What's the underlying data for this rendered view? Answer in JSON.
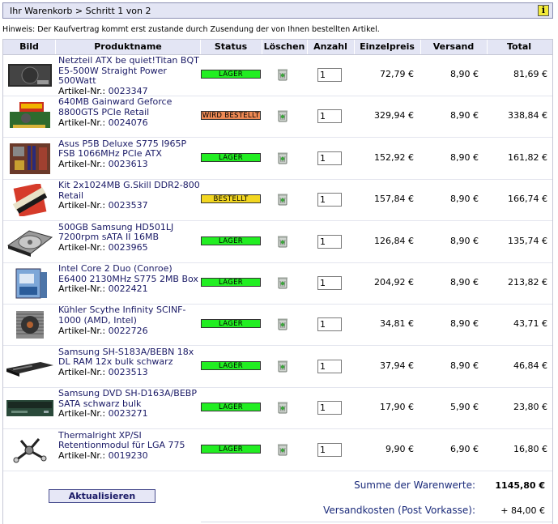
{
  "breadcrumb": "Ihr Warenkorb > Schritt 1 von 2",
  "info_icon": "i",
  "hint": "Hinweis: Der Kaufvertrag kommt erst zustande durch Zusendung der von Ihnen bestellten Artikel.",
  "columns": {
    "bild": "Bild",
    "produktname": "Produktname",
    "status": "Status",
    "loeschen": "Löschen",
    "anzahl": "Anzahl",
    "einzelpreis": "Einzelpreis",
    "versand": "Versand",
    "total": "Total"
  },
  "article_label": "Artikel-Nr.:",
  "status_colors": {
    "LAGER": "#22ee22",
    "WIRD BESTELLT": "#ee8a55",
    "BESTELLT": "#f2d620"
  },
  "items": [
    {
      "name": "Netzteil ATX be quiet!Titan BQT E5-500W Straight Power 500Watt",
      "article": "0023347",
      "status": "LAGER",
      "qty": "1",
      "unit_price": "72,79 €",
      "shipping": "8,90 €",
      "total": "81,69 €",
      "thumb": "psu-image"
    },
    {
      "name": "640MB Gainward Geforce 8800GTS PCIe Retail",
      "article": "0024076",
      "status": "WIRD BESTELLT",
      "qty": "1",
      "unit_price": "329,94 €",
      "shipping": "8,90 €",
      "total": "338,84 €",
      "thumb": "graphics-card-image"
    },
    {
      "name": "Asus P5B Deluxe S775 I965P FSB 1066MHz PCIe ATX",
      "article": "0023613",
      "status": "LAGER",
      "qty": "1",
      "unit_price": "152,92 €",
      "shipping": "8,90 €",
      "total": "161,82 €",
      "thumb": "motherboard-image"
    },
    {
      "name": "Kit 2x1024MB G.Skill DDR2-800 Retail",
      "article": "0023537",
      "status": "BESTELLT",
      "qty": "1",
      "unit_price": "157,84 €",
      "shipping": "8,90 €",
      "total": "166,74 €",
      "thumb": "ram-kit-image"
    },
    {
      "name": "500GB Samsung HD501LJ 7200rpm sATA II 16MB",
      "article": "0023965",
      "status": "LAGER",
      "qty": "1",
      "unit_price": "126,84 €",
      "shipping": "8,90 €",
      "total": "135,74 €",
      "thumb": "hard-drive-image"
    },
    {
      "name": "Intel Core 2 Duo (Conroe) E6400 2130MHz S775 2MB Box",
      "article": "0022421",
      "status": "LAGER",
      "qty": "1",
      "unit_price": "204,92 €",
      "shipping": "8,90 €",
      "total": "213,82 €",
      "thumb": "cpu-box-image"
    },
    {
      "name": "Kühler Scythe Infinity SCINF-1000 (AMD, Intel)",
      "article": "0022726",
      "status": "LAGER",
      "qty": "1",
      "unit_price": "34,81 €",
      "shipping": "8,90 €",
      "total": "43,71 €",
      "thumb": "cpu-cooler-image"
    },
    {
      "name": "Samsung SH-S183A/BEBN 18x DL RAM 12x bulk schwarz",
      "article": "0023513",
      "status": "LAGER",
      "qty": "1",
      "unit_price": "37,94 €",
      "shipping": "8,90 €",
      "total": "46,84 €",
      "thumb": "dvd-burner-image"
    },
    {
      "name": "Samsung DVD SH-D163A/BEBP SATA schwarz bulk",
      "article": "0023271",
      "status": "LAGER",
      "qty": "1",
      "unit_price": "17,90 €",
      "shipping": "5,90 €",
      "total": "23,80 €",
      "thumb": "dvd-drive-image"
    },
    {
      "name": "Thermalright XP/SI Retentionmodul für LGA 775",
      "article": "0019230",
      "status": "LAGER",
      "qty": "1",
      "unit_price": "9,90 €",
      "shipping": "6,90 €",
      "total": "16,80 €",
      "thumb": "retention-module-image"
    }
  ],
  "refresh_label": "Aktualisieren",
  "summary": {
    "subtotal_label": "Summe der Warenwerte:",
    "subtotal_value": "1145,80 €",
    "shipping_label": "Versandkosten (Post Vorkasse):",
    "shipping_value": "+ 84,00 €"
  }
}
